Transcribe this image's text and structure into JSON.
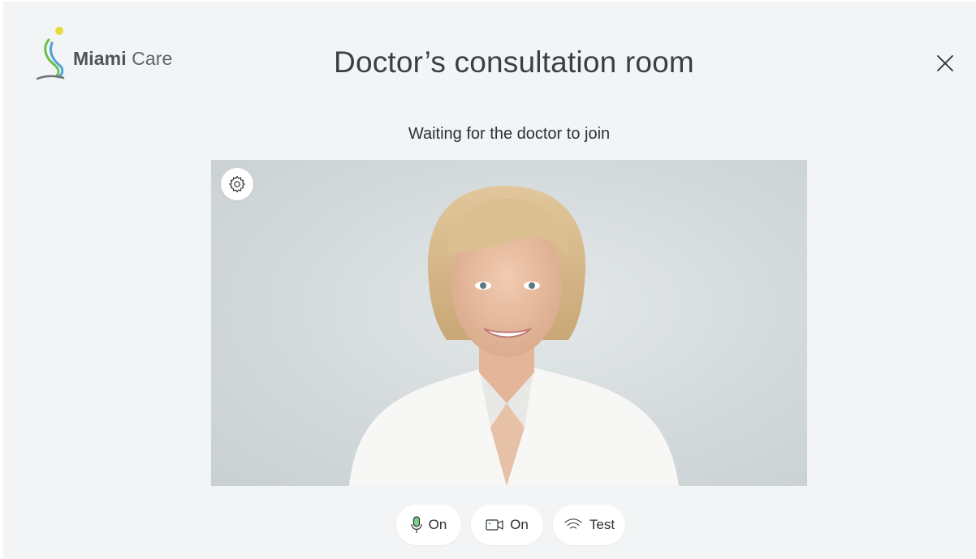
{
  "brand": {
    "name_bold": "Miami",
    "name_light": "Care",
    "logo_icon": "miami-care-logo",
    "colors": {
      "yellow": "#e6d93a",
      "green": "#6cbf4a",
      "blue": "#4aa3d6",
      "gray": "#6e7275"
    }
  },
  "header": {
    "title": "Doctor’s consultation room",
    "close_icon": "close-icon"
  },
  "status": {
    "waiting_text": "Waiting for the doctor to join"
  },
  "preview": {
    "settings_icon": "gear-icon"
  },
  "controls": {
    "microphone": {
      "icon": "microphone-icon",
      "label": "On"
    },
    "camera": {
      "icon": "camera-icon",
      "label": "On"
    },
    "network_test": {
      "icon": "wifi-icon",
      "label": "Test"
    }
  }
}
